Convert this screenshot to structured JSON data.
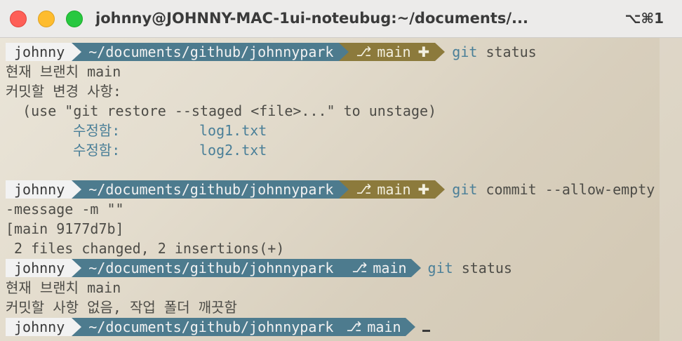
{
  "window": {
    "title": "johnny@JOHNNY-MAC-1ui-noteubug:~/documents/...",
    "shortcut": "⌥⌘1"
  },
  "prompt": {
    "user": "johnny",
    "path": "~/documents/github/johnnypark",
    "branch": "main",
    "dirty_marker": "✚"
  },
  "lines": {
    "cmd1_git": "git",
    "cmd1_rest": " status",
    "out1": "현재 브랜치 main",
    "out2": "커밋할 변경 사항:",
    "out3": "  (use \"git restore --staged <file>...\" to unstage)",
    "mod1_label": "수정함:",
    "mod1_file": "log1.txt",
    "mod2_label": "수정함:",
    "mod2_file": "log2.txt",
    "cmd2_git": "git",
    "cmd2_rest": " commit --allow-empty",
    "cmd2_wrap": "-message -m \"\"",
    "out4": "[main 9177d7b]",
    "out5": " 2 files changed, 2 insertions(+)",
    "cmd3_git": "git",
    "cmd3_rest": " status",
    "out6": "현재 브랜치 main",
    "out7": "커밋할 사항 없음, 작업 폴더 깨끗함"
  }
}
